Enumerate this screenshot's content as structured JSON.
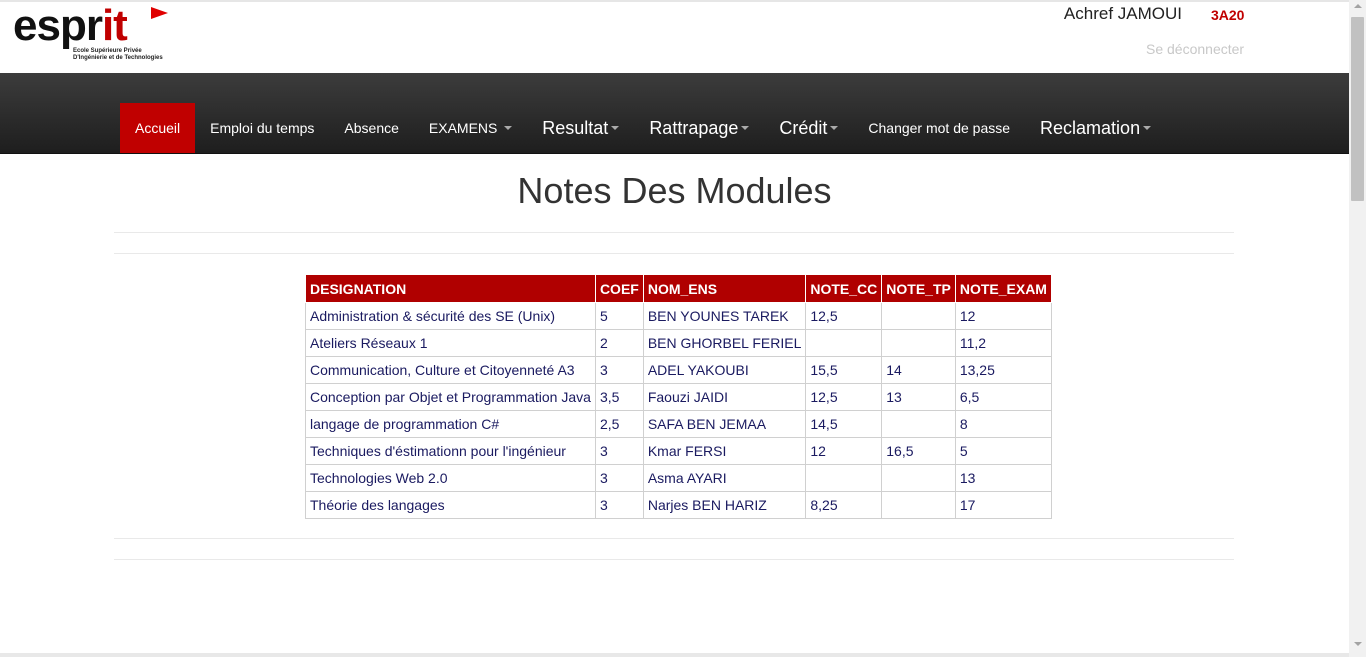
{
  "header": {
    "logo_text": "esprit",
    "logo_subtitle_1": "Ecole Supérieure Privée",
    "logo_subtitle_2": "D'Ingénierie et de Technologies",
    "user_name": "Achref JAMOUI",
    "user_class": "3A20",
    "logout_label": "Se déconnecter"
  },
  "nav": {
    "items": [
      {
        "label": "Accueil"
      },
      {
        "label": "Emploi du temps"
      },
      {
        "label": "Absence"
      },
      {
        "label": "EXAMENS"
      },
      {
        "label": "Resultat"
      },
      {
        "label": "Rattrapage"
      },
      {
        "label": "Crédit"
      },
      {
        "label": "Changer mot de passe"
      },
      {
        "label": "Reclamation"
      }
    ]
  },
  "main": {
    "title": "Notes Des Modules"
  },
  "table": {
    "columns": [
      "DESIGNATION",
      "COEF",
      "NOM_ENS",
      "NOTE_CC",
      "NOTE_TP",
      "NOTE_EXAM"
    ],
    "rows": [
      [
        "Administration & sécurité des SE (Unix)",
        "5",
        "BEN YOUNES TAREK",
        "12,5",
        "",
        "12"
      ],
      [
        "Ateliers Réseaux 1",
        "2",
        "BEN GHORBEL FERIEL",
        "",
        "",
        "11,2"
      ],
      [
        "Communication, Culture et Citoyenneté A3",
        "3",
        "ADEL YAKOUBI",
        "15,5",
        "14",
        "13,25"
      ],
      [
        "Conception par Objet et Programmation Java",
        "3,5",
        "Faouzi JAIDI",
        "12,5",
        "13",
        "6,5"
      ],
      [
        "langage de programmation C#",
        "2,5",
        "SAFA BEN JEMAA",
        "14,5",
        "",
        "8"
      ],
      [
        "Techniques d'éstimationn pour l'ingénieur",
        "3",
        "Kmar FERSI",
        "12",
        "16,5",
        "5"
      ],
      [
        "Technologies Web 2.0",
        "3",
        "Asma AYARI",
        "",
        "",
        "13"
      ],
      [
        "Théorie des langages",
        "3",
        "Narjes BEN HARIZ",
        "8,25",
        "",
        "17"
      ]
    ]
  },
  "colors": {
    "accent": "#c00000",
    "navbar": "#2a2a2a",
    "table_header": "#b00000"
  }
}
